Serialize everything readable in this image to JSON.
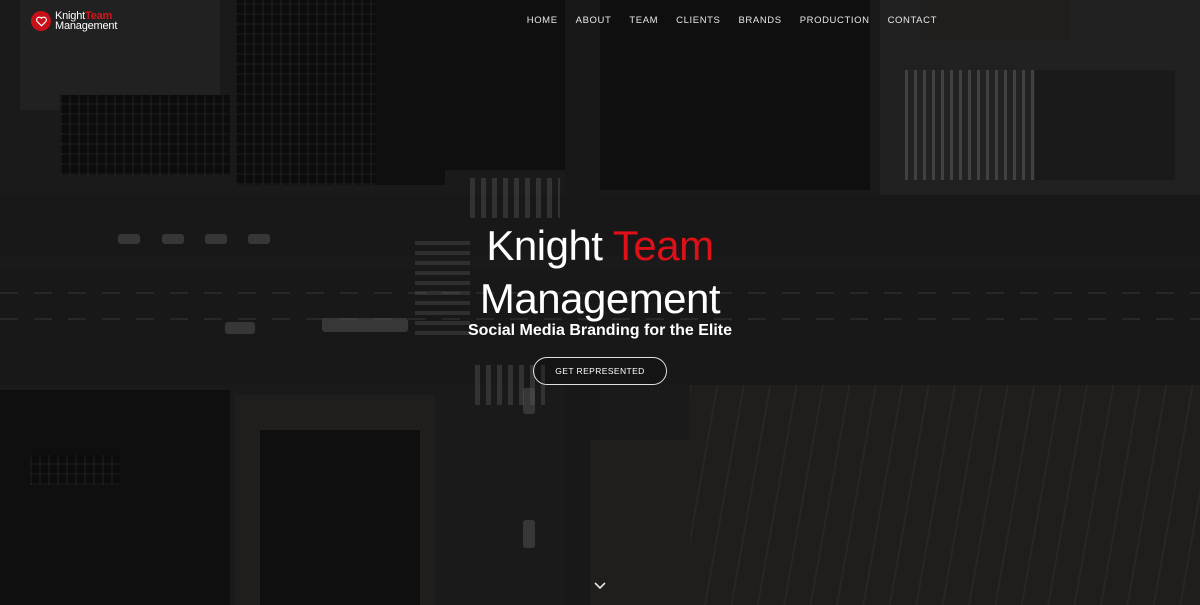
{
  "brand": {
    "logo_word1": "Knight",
    "logo_word2": "Team",
    "logo_word3": "Management",
    "accent_color": "#d8141d"
  },
  "nav": {
    "items": [
      "HOME",
      "ABOUT",
      "TEAM",
      "CLIENTS",
      "BRANDS",
      "PRODUCTION",
      "CONTACT"
    ]
  },
  "hero": {
    "title_word1": "Knight",
    "title_word2": "Team",
    "title_line2": "Management",
    "tagline": "Social Media Branding for the Elite",
    "cta_label": "GET REPRESENTED",
    "scroll_icon": "chevron-down-icon"
  }
}
